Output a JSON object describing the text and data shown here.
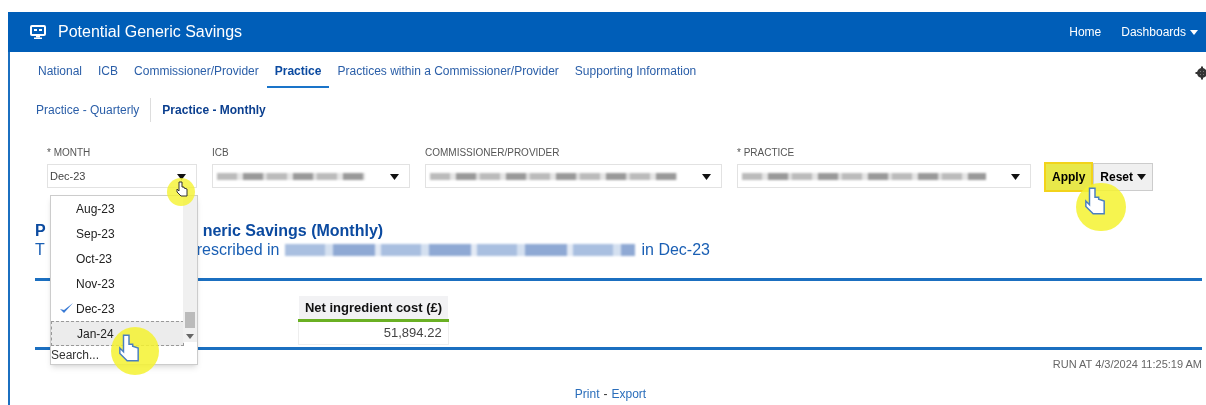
{
  "header": {
    "title": "Potential Generic Savings",
    "nav": [
      {
        "label": "Home",
        "menu": false
      },
      {
        "label": "Dashboards",
        "menu": true
      }
    ]
  },
  "tabs": [
    {
      "label": "National",
      "selected": false
    },
    {
      "label": "ICB",
      "selected": false
    },
    {
      "label": "Commissioner/Provider",
      "selected": false
    },
    {
      "label": "Practice",
      "selected": true
    },
    {
      "label": "Practices within a Commissioner/Provider",
      "selected": false
    },
    {
      "label": "Supporting Information",
      "selected": false
    }
  ],
  "subtabs": [
    {
      "label": "Practice - Quarterly",
      "selected": false
    },
    {
      "label": "Practice - Monthly",
      "selected": true
    }
  ],
  "filters": [
    {
      "label": "* MONTH",
      "kind": "text",
      "value": "Dec-23"
    },
    {
      "label": "ICB",
      "kind": "redacted"
    },
    {
      "label": "COMMISSIONER/PROVIDER",
      "kind": "redacted"
    },
    {
      "label": "* PRACTICE",
      "kind": "redacted"
    }
  ],
  "buttons": [
    {
      "label": "Apply",
      "kind": "apply",
      "highlighted": true
    },
    {
      "label": "Reset",
      "kind": "menu",
      "highlighted": false
    }
  ],
  "month_dropdown": {
    "options": [
      {
        "label": "Aug-23",
        "checked": false,
        "hovered": false
      },
      {
        "label": "Sep-23",
        "checked": false,
        "hovered": false
      },
      {
        "label": "Oct-23",
        "checked": false,
        "hovered": false
      },
      {
        "label": "Nov-23",
        "checked": false,
        "hovered": false
      },
      {
        "label": "Dec-23",
        "checked": true,
        "hovered": false
      },
      {
        "label": "Jan-24",
        "checked": false,
        "hovered": true
      }
    ],
    "search": "Search..."
  },
  "report": {
    "title_parts": [
      "P",
      "neric Savings (Monthly)"
    ],
    "subtitle_parts": [
      "T",
      "rescribed in",
      "in Dec-23"
    ],
    "table": {
      "columns": [
        "Net ingredient cost (£)"
      ],
      "rows": [
        [
          "51,894.22"
        ]
      ]
    },
    "run_at": "RUN AT 4/3/2024 11:25:19 AM",
    "links": [
      "Print",
      "-",
      "Export"
    ]
  }
}
